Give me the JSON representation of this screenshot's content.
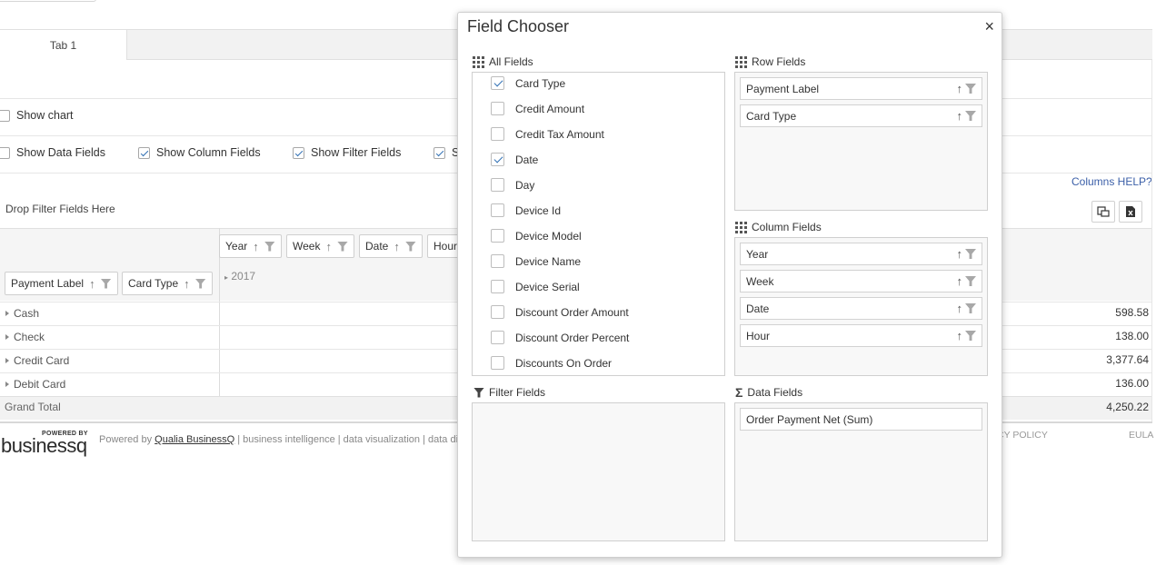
{
  "page": {
    "tab_label": "Tab 1",
    "show_chart_label": "Show chart",
    "options": [
      {
        "label": "Show Data Fields",
        "checked": false
      },
      {
        "label": "Show Column Fields",
        "checked": true
      },
      {
        "label": "Show Filter Fields",
        "checked": true
      },
      {
        "label": "S",
        "checked": true
      }
    ],
    "columns_help": "Columns HELP?",
    "drop_filter": "Drop Filter Fields Here",
    "column_chips": [
      "Year",
      "Week",
      "Date",
      "Hour"
    ],
    "row_chips": [
      "Payment Label",
      "Card Type"
    ],
    "year_label": "2017",
    "rows": [
      {
        "label": "Cash",
        "value": "598.58"
      },
      {
        "label": "Check",
        "value": "138.00"
      },
      {
        "label": "Credit Card",
        "value": "3,377.64"
      },
      {
        "label": "Debit Card",
        "value": "136.00"
      }
    ],
    "grand_total": {
      "label": "Grand Total",
      "value": "4,250.22"
    },
    "footer": {
      "powered_small": "POWERED BY",
      "logo": "businessq",
      "powered_prefix": "Powered by ",
      "powered_link": "Qualia BusinessQ",
      "powered_suffix": " | business intelligence | data visualization | data disc",
      "privacy": "CY POLICY",
      "eula": "EULA"
    }
  },
  "dialog": {
    "title": "Field Chooser",
    "close": "×",
    "all_fields_title": "All Fields",
    "row_fields_title": "Row Fields",
    "column_fields_title": "Column Fields",
    "filter_fields_title": "Filter Fields",
    "data_fields_title": "Data Fields",
    "all_fields": [
      {
        "label": "Card Type",
        "checked": true
      },
      {
        "label": "Credit Amount",
        "checked": false
      },
      {
        "label": "Credit Tax Amount",
        "checked": false
      },
      {
        "label": "Date",
        "checked": true
      },
      {
        "label": "Day",
        "checked": false
      },
      {
        "label": "Device Id",
        "checked": false
      },
      {
        "label": "Device Model",
        "checked": false
      },
      {
        "label": "Device Name",
        "checked": false
      },
      {
        "label": "Device Serial",
        "checked": false
      },
      {
        "label": "Discount Order Amount",
        "checked": false
      },
      {
        "label": "Discount Order Percent",
        "checked": false
      },
      {
        "label": "Discounts On Order",
        "checked": false
      }
    ],
    "row_fields": [
      "Payment Label",
      "Card Type"
    ],
    "column_fields": [
      "Year",
      "Week",
      "Date",
      "Hour"
    ],
    "data_fields": [
      "Order Payment Net (Sum)"
    ]
  },
  "icons": {
    "sort": "sort-arrow-icon",
    "filter": "funnel-icon",
    "grid": "grid-icon",
    "sigma": "sigma-icon",
    "check": "checkmark-icon",
    "caret": "caret-right-icon",
    "fullscreen": "expand-icon",
    "excel": "excel-export-icon"
  }
}
